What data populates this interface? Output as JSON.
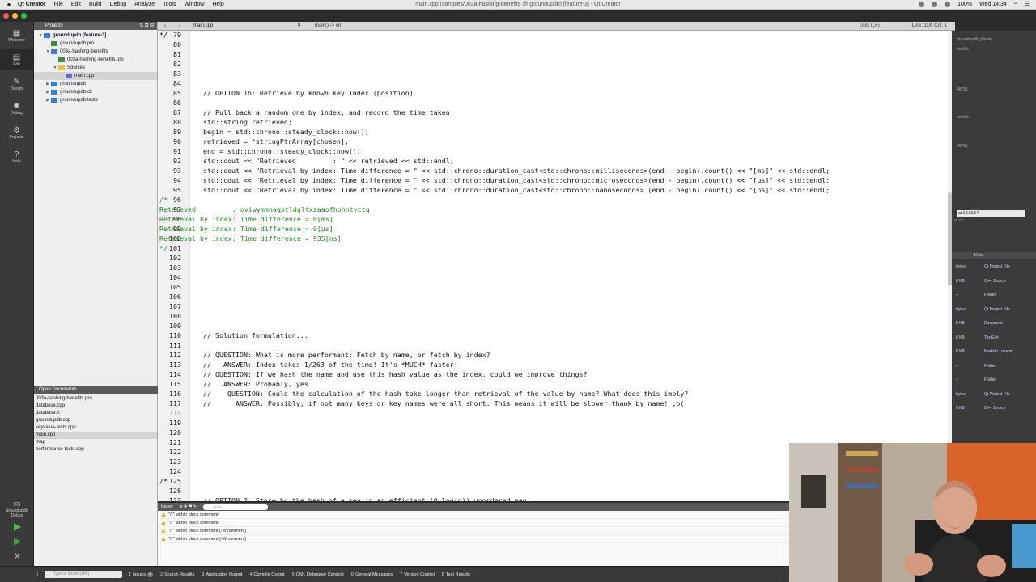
{
  "menubar": {
    "app": "Qt Creator",
    "items": [
      "File",
      "Edit",
      "Build",
      "Debug",
      "Analyze",
      "Tools",
      "Window",
      "Help"
    ],
    "window_title": "main.cpp (samples/003a-hashing-benefits @ groundupdb) [feature-3] - Qt Creator",
    "battery": "100%",
    "clock": "Wed 14:34"
  },
  "modes": [
    {
      "label": "Welcome",
      "icon": "grid-icon"
    },
    {
      "label": "Edit",
      "icon": "document-icon"
    },
    {
      "label": "Design",
      "icon": "pencil-icon"
    },
    {
      "label": "Debug",
      "icon": "bug-icon"
    },
    {
      "label": "Projects",
      "icon": "wrench-icon"
    },
    {
      "label": "Help",
      "icon": "help-icon"
    }
  ],
  "mode_bottom": {
    "project_label": "groundupdb",
    "debug_label": "Debug"
  },
  "projects": {
    "title": "Projects",
    "tree": [
      {
        "label": "groundupdb [feature-3]",
        "arrow": "▼",
        "bold": true,
        "color": "#3a7bd5"
      },
      {
        "label": "groundupdb.pro",
        "arrow": "",
        "color": "#3b8e3b"
      },
      {
        "label": "003a-hashing-benefits",
        "arrow": "▼",
        "color": "#3a7bd5"
      },
      {
        "label": "003a-hashing-benefits.pro",
        "arrow": "",
        "color": "#3b8e3b"
      },
      {
        "label": "Sources",
        "arrow": "▼",
        "color": "#f0c040"
      },
      {
        "label": "main.cpp",
        "arrow": "",
        "color": "#6a6ac0",
        "selected": true
      },
      {
        "label": "groundupdb",
        "arrow": "▶",
        "color": "#3a7bd5"
      },
      {
        "label": "groundupdb-cli",
        "arrow": "▶",
        "color": "#3a7bd5"
      },
      {
        "label": "groundupdb-tests",
        "arrow": "▶",
        "color": "#3a7bd5"
      }
    ],
    "indents": [
      0,
      1,
      1,
      2,
      2,
      3,
      1,
      1,
      1
    ]
  },
  "open_documents": {
    "title": "Open Documents",
    "items": [
      {
        "label": "003a-hashing-benefits.pro"
      },
      {
        "label": "database.cpp"
      },
      {
        "label": "database.h"
      },
      {
        "label": "groundupdb.cpp"
      },
      {
        "label": "keyvalue-tests.cpp"
      },
      {
        "label": "main.cpp",
        "selected": true
      },
      {
        "label": "map"
      },
      {
        "label": "performance-tests.cpp"
      }
    ]
  },
  "editor_tabs": {
    "file": "main.cpp",
    "function": "main() -> int",
    "line_endings": "Unix (LF)",
    "position": "Line: 118, Col: 1"
  },
  "editor": {
    "lines": [
      {
        "n": "79",
        "t": "*/",
        "c": "plain"
      },
      {
        "n": "80",
        "t": "",
        "c": "plain"
      },
      {
        "n": "81",
        "t": "",
        "c": "plain"
      },
      {
        "n": "82",
        "t": "",
        "c": "plain"
      },
      {
        "n": "83",
        "t": "",
        "c": "plain"
      },
      {
        "n": "84",
        "t": "",
        "c": "plain"
      },
      {
        "n": "85",
        "t": "  // OPTION 1b: Retrieve by known key index (position)",
        "c": "plain"
      },
      {
        "n": "86",
        "t": "",
        "c": "plain"
      },
      {
        "n": "87",
        "t": "  // Pull back a random one by index, and record the time taken",
        "c": "plain"
      },
      {
        "n": "88",
        "t": "  std::string retrieved;",
        "c": "plain"
      },
      {
        "n": "89",
        "t": "  begin = std::chrono::steady_clock::now();",
        "c": "plain"
      },
      {
        "n": "90",
        "t": "  retrieved = *stringPtrArray[chosen];",
        "c": "plain"
      },
      {
        "n": "91",
        "t": "  end = std::chrono::steady_clock::now();",
        "c": "plain"
      },
      {
        "n": "92",
        "t": "  std::cout << \"Retrieved         : \" << retrieved << std::endl;",
        "c": "plain"
      },
      {
        "n": "93",
        "t": "  std::cout << \"Retrieval by index: Time difference = \" << std::chrono::duration_cast<std::chrono::milliseconds>(end - begin).count() << \"[ms]\" << std::endl;",
        "c": "plain"
      },
      {
        "n": "94",
        "t": "  std::cout << \"Retrieval by index: Time difference = \" << std::chrono::duration_cast<std::chrono::microseconds>(end - begin).count() << \"[µs]\" << std::endl;",
        "c": "plain"
      },
      {
        "n": "95",
        "t": "  std::cout << \"Retrieval by index: Time difference = \" << std::chrono::duration_cast<std::chrono::nanoseconds> (end - begin).count() << \"[ns]\" << std::endl;",
        "c": "plain"
      },
      {
        "n": "96",
        "t": "/*",
        "c": "green"
      },
      {
        "n": "97",
        "t": "Retrieved         : oviwymmnaqptldgltxzaaofhohntvctq",
        "c": "green"
      },
      {
        "n": "98",
        "t": "Retrieval by index: Time difference = 0[ms]",
        "c": "green"
      },
      {
        "n": "99",
        "t": "Retrieval by index: Time difference = 0[µs]",
        "c": "green"
      },
      {
        "n": "100",
        "t": "Retrieval by index: Time difference = 935[ns]",
        "c": "green"
      },
      {
        "n": "101",
        "t": "*/",
        "c": "green"
      },
      {
        "n": "102",
        "t": "",
        "c": "plain"
      },
      {
        "n": "103",
        "t": "",
        "c": "plain"
      },
      {
        "n": "104",
        "t": "",
        "c": "plain"
      },
      {
        "n": "105",
        "t": "",
        "c": "plain"
      },
      {
        "n": "106",
        "t": "",
        "c": "plain"
      },
      {
        "n": "107",
        "t": "",
        "c": "plain"
      },
      {
        "n": "108",
        "t": "",
        "c": "plain"
      },
      {
        "n": "109",
        "t": "",
        "c": "plain"
      },
      {
        "n": "110",
        "t": "  // Solution formulation...",
        "c": "plain"
      },
      {
        "n": "111",
        "t": "",
        "c": "plain"
      },
      {
        "n": "112",
        "t": "  // QUESTION: What is more performant: Fetch by name, or fetch by index?",
        "c": "plain"
      },
      {
        "n": "113",
        "t": "  //   ANSWER: Index takes 1/263 of the time! It's *MUCH* faster!",
        "c": "plain"
      },
      {
        "n": "114",
        "t": "  // QUESTION: If we hash the name and use this hash value as the index, could we improve things?",
        "c": "plain"
      },
      {
        "n": "115",
        "t": "  //   ANSWER: Probably, yes",
        "c": "plain"
      },
      {
        "n": "116",
        "t": "  //    QUESTION: Could the calculation of the hash take longer than retrieval of the value by name? What does this imply?",
        "c": "plain"
      },
      {
        "n": "117",
        "t": "  //      ANSWER: Possibly, if not many keys or key names were all short. This means it will be slower thank by name! ;o(",
        "c": "plain"
      },
      {
        "n": "118",
        "t": "",
        "c": "plain",
        "dim": true
      },
      {
        "n": "119",
        "t": "",
        "c": "plain"
      },
      {
        "n": "120",
        "t": "",
        "c": "plain"
      },
      {
        "n": "121",
        "t": "",
        "c": "plain"
      },
      {
        "n": "122",
        "t": "",
        "c": "plain"
      },
      {
        "n": "123",
        "t": "",
        "c": "plain"
      },
      {
        "n": "124",
        "t": "",
        "c": "plain"
      },
      {
        "n": "125",
        "t": "/*",
        "c": "plain"
      },
      {
        "n": "126",
        "t": "",
        "c": "plain"
      },
      {
        "n": "127",
        "t": "  // OPTION 2: Store by the hash of a key in an efficient (O log(n)) unordered map",
        "c": "plain"
      }
    ]
  },
  "right_panel": {
    "files": [
      {
        "label": "groundupdb_darwin"
      },
      {
        "label": "enefits"
      },
      {
        "label": "48751"
      },
      {
        "label": "enefits"
      },
      {
        "label": "48751"
      }
    ],
    "tooltip": "at 14:33:14",
    "size": "15 GB",
    "kind_header": "Kind",
    "kinds": [
      {
        "size": "bytes",
        "kind": "Qt Project File"
      },
      {
        "size": "8 KB",
        "kind": "C++ Source"
      },
      {
        "size": "--",
        "kind": "Folder"
      },
      {
        "size": "bytes",
        "kind": "Qt Project File"
      },
      {
        "size": "8 KB",
        "kind": "Document"
      },
      {
        "size": "8 KB",
        "kind": "TextEdit"
      },
      {
        "size": "8 KB",
        "kind": "Markdo...ument"
      },
      {
        "size": "--",
        "kind": "Folder"
      },
      {
        "size": "--",
        "kind": "Folder"
      },
      {
        "size": "bytes",
        "kind": "Qt Project File"
      },
      {
        "size": "8 KB",
        "kind": "C++ Source"
      }
    ]
  },
  "issues": {
    "title": "Issues",
    "filter_placeholder": "Filter",
    "items": [
      {
        "text": "\"/*\" within block comment"
      },
      {
        "text": "\"/*\" within block comment"
      },
      {
        "text": "\"/*\" within block comment [-Wcomment]"
      },
      {
        "text": "\"/*\" within block comment [-Wcomment]"
      }
    ]
  },
  "bottombar": {
    "locator_placeholder": "Type to locate (⌘K)",
    "tabs": [
      {
        "num": "1",
        "label": "Issues",
        "badge": "4"
      },
      {
        "num": "2",
        "label": "Search Results"
      },
      {
        "num": "3",
        "label": "Application Output"
      },
      {
        "num": "4",
        "label": "Compile Output"
      },
      {
        "num": "5",
        "label": "QML Debugger Console"
      },
      {
        "num": "6",
        "label": "General Messages"
      },
      {
        "num": "7",
        "label": "Version Control"
      },
      {
        "num": "8",
        "label": "Test Results"
      }
    ]
  }
}
